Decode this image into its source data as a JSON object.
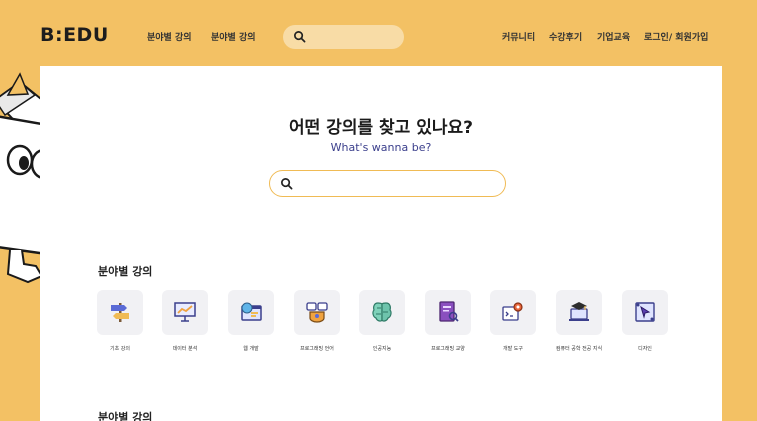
{
  "header": {
    "logo": "B:EDU",
    "nav_left": [
      "분야별 강의",
      "분야별 강의"
    ],
    "nav_right": [
      "커뮤니티",
      "수강후기",
      "기업교육",
      "로그인/ 회원가입"
    ]
  },
  "hero": {
    "title": "어떤 강의를 찾고 있나요?",
    "subtitle": "What's wanna be?"
  },
  "sections": {
    "first_title": "분야별 강의",
    "second_title": "분야별 강의"
  },
  "categories": [
    {
      "label": "기초 강의",
      "icon": "signpost-icon"
    },
    {
      "label": "데이터 분석",
      "icon": "presentation-chart-icon"
    },
    {
      "label": "웹 개발",
      "icon": "web-browser-icon"
    },
    {
      "label": "프로그래밍 언어",
      "icon": "code-language-icon"
    },
    {
      "label": "인공지능",
      "icon": "circuit-brain-icon"
    },
    {
      "label": "프로그래밍 교양",
      "icon": "book-icon"
    },
    {
      "label": "개발 도구",
      "icon": "dev-tools-gear-icon"
    },
    {
      "label": "컴퓨터 공학 전공 지식",
      "icon": "graduation-laptop-icon"
    },
    {
      "label": "디자인",
      "icon": "design-pen-icon"
    }
  ],
  "colors": {
    "background": "#f3c164",
    "accent_navy": "#3b3f8c",
    "search_fill": "#f8dca6",
    "search_border": "#f0bb55"
  }
}
